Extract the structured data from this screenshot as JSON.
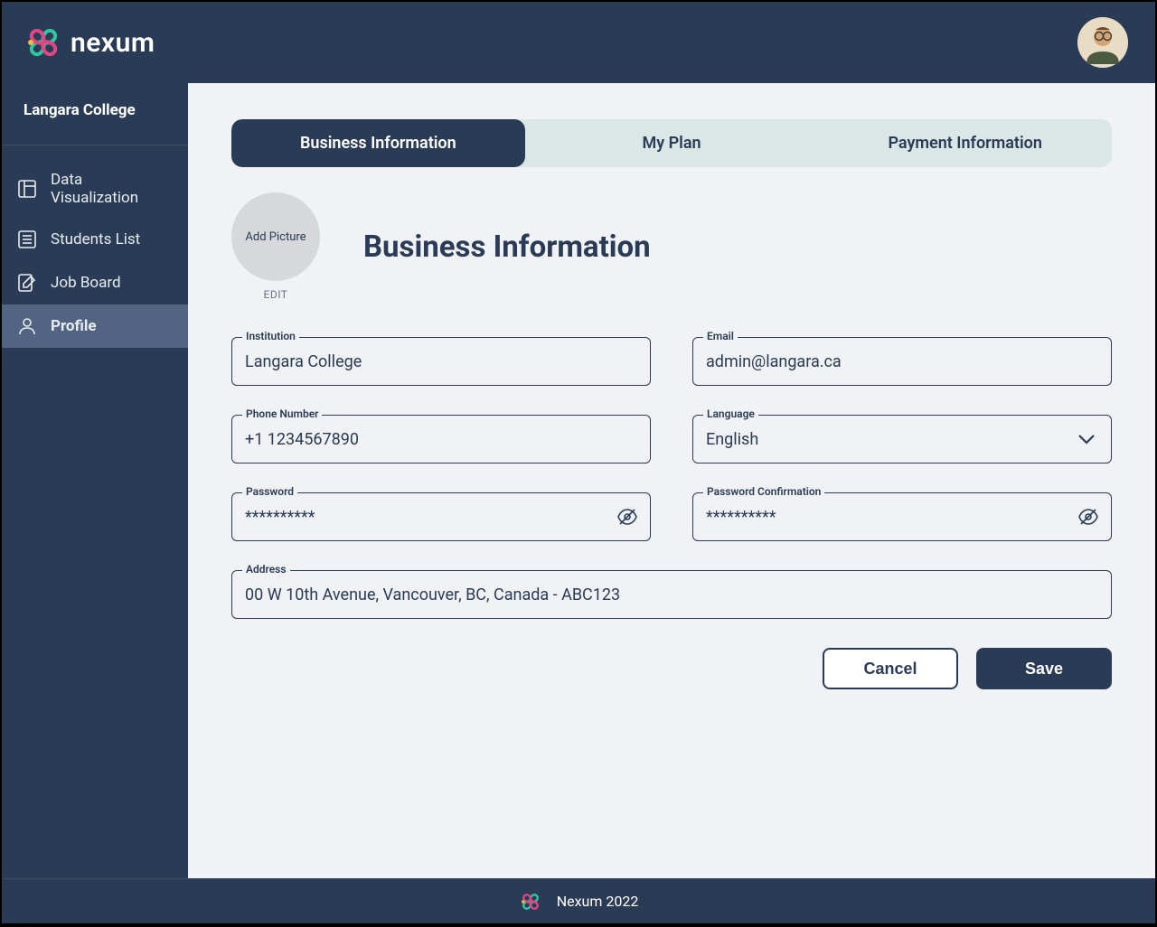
{
  "brand": {
    "name": "nexum"
  },
  "user": {
    "org": "Langara College"
  },
  "sidebar": {
    "items": [
      {
        "label": "Data Visualization"
      },
      {
        "label": "Students List"
      },
      {
        "label": "Job Board"
      },
      {
        "label": "Profile"
      }
    ]
  },
  "tabs": [
    {
      "label": "Business Information"
    },
    {
      "label": "My Plan"
    },
    {
      "label": "Payment Information"
    }
  ],
  "page": {
    "title": "Business Information",
    "add_picture": "Add Picture",
    "edit": "EDIT"
  },
  "form": {
    "institution": {
      "label": "Institution",
      "value": "Langara College"
    },
    "email": {
      "label": "Email",
      "value": "admin@langara.ca"
    },
    "phone": {
      "label": "Phone Number",
      "value": "+1 1234567890"
    },
    "language": {
      "label": "Language",
      "value": "English"
    },
    "password": {
      "label": "Password",
      "value": "**********"
    },
    "password_confirm": {
      "label": "Password Confirmation",
      "value": "**********"
    },
    "address": {
      "label": "Address",
      "value": "00 W 10th Avenue, Vancouver, BC, Canada - ABC123"
    }
  },
  "actions": {
    "cancel": "Cancel",
    "save": "Save"
  },
  "footer": {
    "text": "Nexum 2022"
  }
}
